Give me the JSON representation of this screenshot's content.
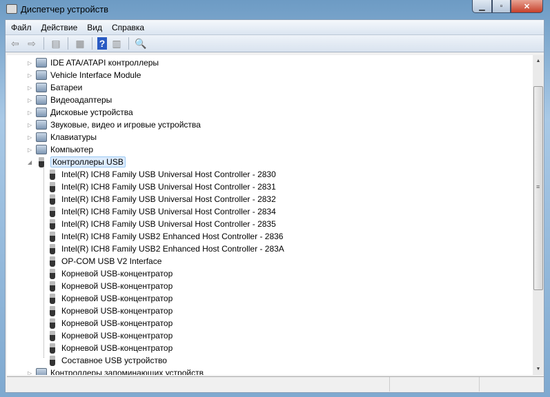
{
  "window": {
    "title": "Диспетчер устройств"
  },
  "menu": [
    "Файл",
    "Действие",
    "Вид",
    "Справка"
  ],
  "toolbar": {
    "icons": [
      "back-icon",
      "forward-icon",
      "show-hide-tree-icon",
      "properties-icon",
      "help-icon",
      "action-pane-icon",
      "scan-hardware-icon"
    ],
    "help_label": "?"
  },
  "tree": {
    "categories_before": [
      "IDE ATA/ATAPI контроллеры",
      "Vehicle Interface Module",
      "Батареи",
      "Видеоадаптеры",
      "Дисковые устройства",
      "Звуковые, видео и игровые устройства",
      "Клавиатуры",
      "Компьютер"
    ],
    "expanded": "Контроллеры USB",
    "children": [
      "Intel(R) ICH8 Family USB Universal Host Controller - 2830",
      "Intel(R) ICH8 Family USB Universal Host Controller - 2831",
      "Intel(R) ICH8 Family USB Universal Host Controller - 2832",
      "Intel(R) ICH8 Family USB Universal Host Controller - 2834",
      "Intel(R) ICH8 Family USB Universal Host Controller - 2835",
      "Intel(R) ICH8 Family USB2 Enhanced Host Controller - 2836",
      "Intel(R) ICH8 Family USB2 Enhanced Host Controller - 283A",
      "OP-COM USB V2 Interface",
      "Корневой USB-концентратор",
      "Корневой USB-концентратор",
      "Корневой USB-концентратор",
      "Корневой USB-концентратор",
      "Корневой USB-концентратор",
      "Корневой USB-концентратор",
      "Корневой USB-концентратор",
      "Составное USB устройство"
    ],
    "after": "Контроллеры запоминающих устройств"
  }
}
